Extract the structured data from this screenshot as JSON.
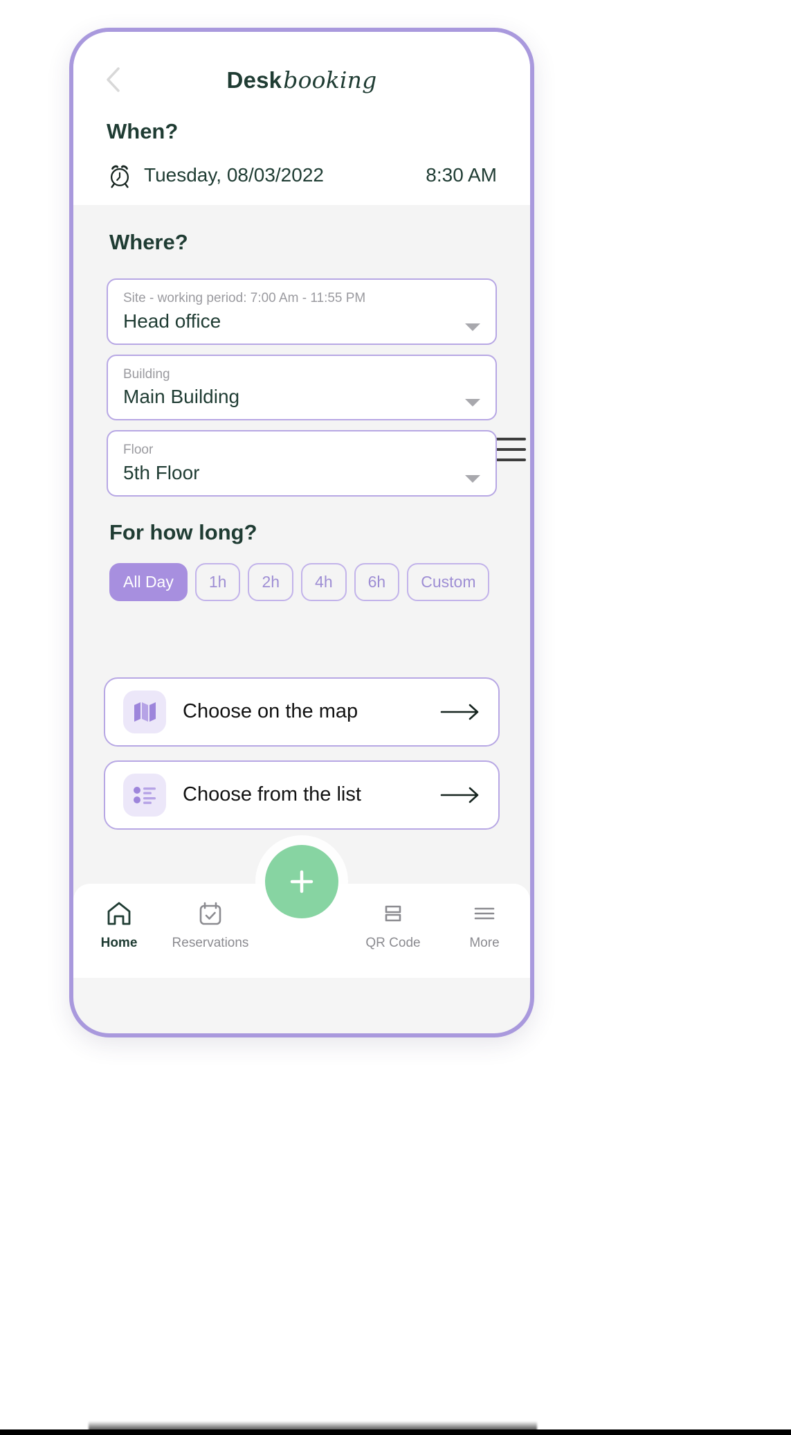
{
  "header": {
    "back_icon": "chevron-left-icon",
    "title_regular": "Desk",
    "title_italic": "booking"
  },
  "when": {
    "section_title": "When?",
    "clock_icon": "alarm-clock-icon",
    "date": "Tuesday, 08/03/2022",
    "time": "8:30 AM"
  },
  "where": {
    "section_title": "Where?",
    "fields": [
      {
        "label": "Site - working period: 7:00 Am - 11:55 PM",
        "value": "Head office"
      },
      {
        "label": "Building",
        "value": "Main Building"
      },
      {
        "label": "Floor",
        "value": "5th Floor"
      }
    ]
  },
  "duration": {
    "section_title": "For how long?",
    "chips": [
      {
        "label": "All Day",
        "active": true
      },
      {
        "label": "1h",
        "active": false
      },
      {
        "label": "2h",
        "active": false
      },
      {
        "label": "4h",
        "active": false
      },
      {
        "label": "6h",
        "active": false
      },
      {
        "label": "Custom",
        "active": false
      }
    ]
  },
  "actions": [
    {
      "icon": "map-icon",
      "label": "Choose on the map",
      "arrow": "arrow-right-icon"
    },
    {
      "icon": "list-icon",
      "label": "Choose from the list",
      "arrow": "arrow-right-icon"
    }
  ],
  "fab": {
    "icon": "plus-icon"
  },
  "navbar": [
    {
      "icon": "home-icon",
      "label": "Home",
      "active": true
    },
    {
      "icon": "calendar-check-icon",
      "label": "Reservations",
      "active": false
    },
    {
      "icon": "qr-code-icon",
      "label": "QR Code",
      "active": false
    },
    {
      "icon": "menu-icon",
      "label": "More",
      "active": false
    }
  ],
  "colors": {
    "accent_purple": "#a78fdf",
    "border_purple": "#b7a7e4",
    "dark_green": "#1f3c33",
    "fab_green": "#87d4a2",
    "muted_grey": "#9a9a9f",
    "page_grey": "#f4f4f4"
  }
}
